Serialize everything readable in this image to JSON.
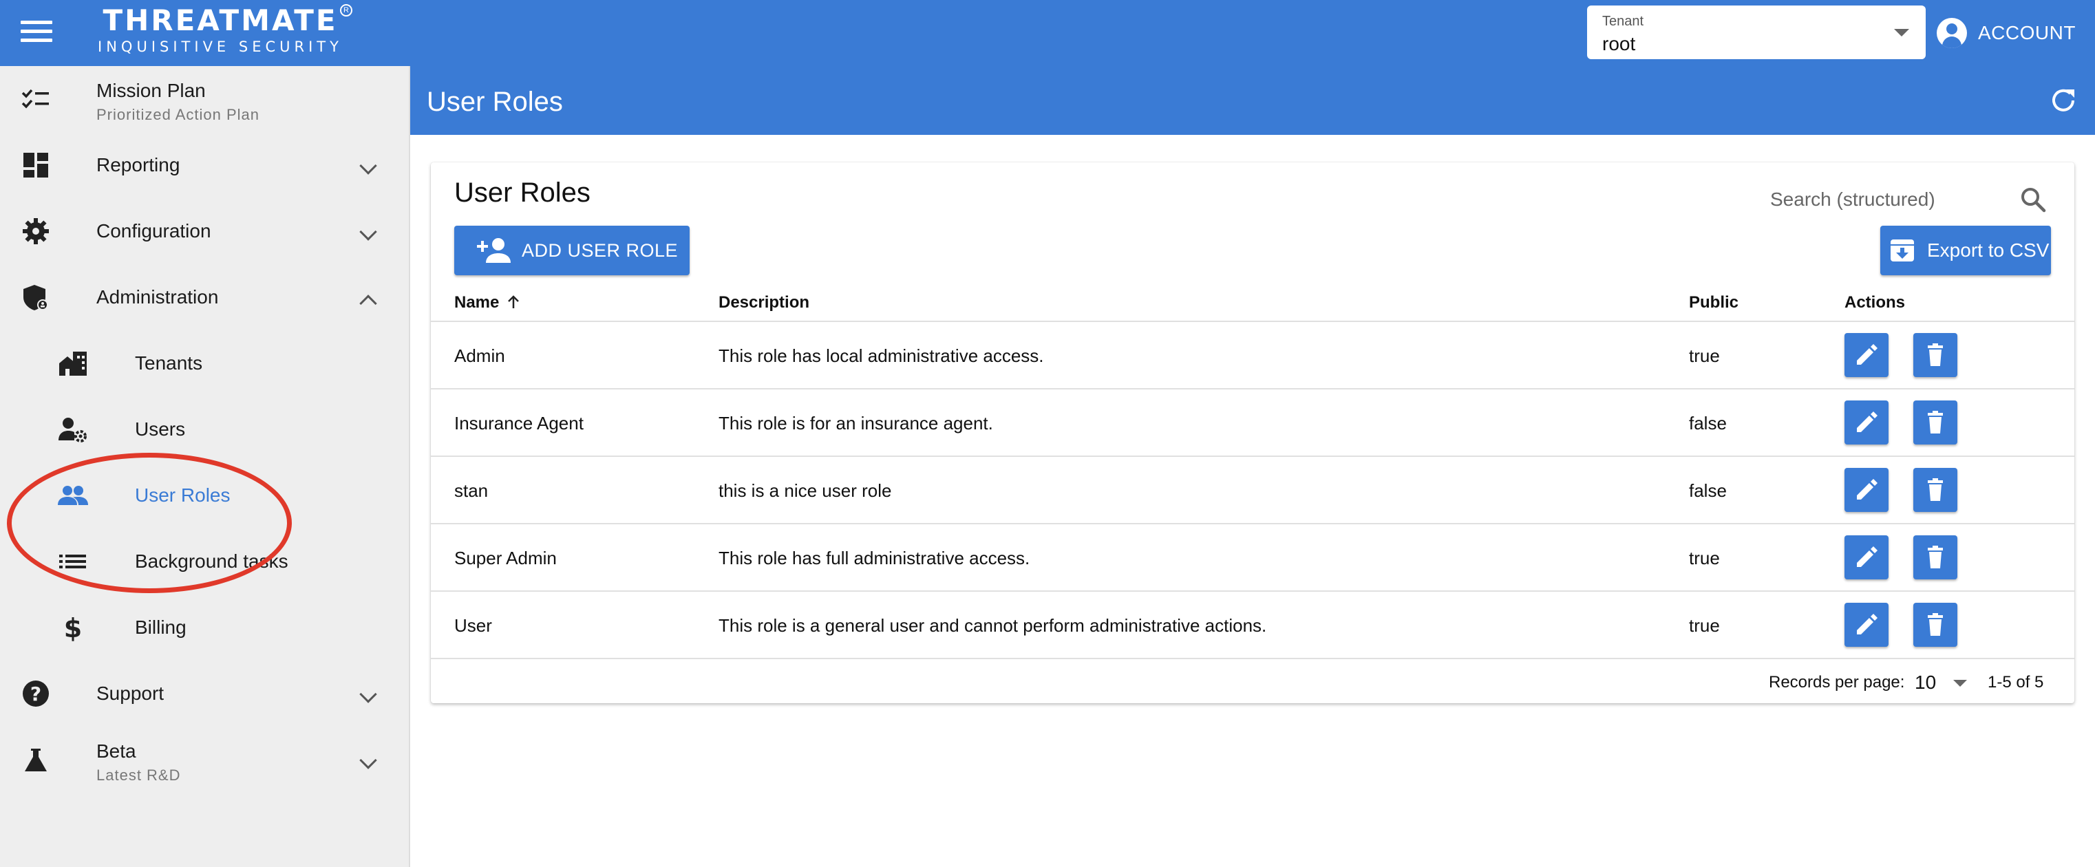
{
  "appbar": {
    "logo_main": "THREATMATE",
    "logo_sub": "INQUISITIVE SECURITY",
    "logo_reg": "R",
    "tenant_label": "Tenant",
    "tenant_value": "root",
    "account_label": "ACCOUNT"
  },
  "sidebar": {
    "items": [
      {
        "label": "Mission Plan",
        "secondary": "Prioritized Action Plan",
        "icon": "checklist-icon"
      },
      {
        "label": "Reporting",
        "icon": "dashboard-icon"
      },
      {
        "label": "Configuration",
        "icon": "gear-icon"
      },
      {
        "label": "Administration",
        "icon": "admin-shield-icon"
      },
      {
        "label": "Tenants",
        "icon": "buildings-icon"
      },
      {
        "label": "Users",
        "icon": "user-settings-icon"
      },
      {
        "label": "User Roles",
        "icon": "people-icon"
      },
      {
        "label": "Background tasks",
        "icon": "list-icon"
      },
      {
        "label": "Billing",
        "icon": "dollar-icon"
      },
      {
        "label": "Support",
        "icon": "help-icon"
      },
      {
        "label": "Beta",
        "secondary": "Latest R&D",
        "icon": "flask-icon"
      }
    ],
    "active": "User Roles"
  },
  "page": {
    "title": "User Roles"
  },
  "card": {
    "title": "User Roles",
    "search_placeholder": "Search (structured)",
    "add_button": "ADD USER ROLE",
    "export_button": "Export to CSV"
  },
  "table": {
    "columns": [
      "Name",
      "Description",
      "Public",
      "Actions"
    ],
    "sort": {
      "column": "Name",
      "direction": "ascending"
    },
    "rows": [
      {
        "name": "Admin",
        "description": "This role has local administrative access.",
        "public": "true"
      },
      {
        "name": "Insurance Agent",
        "description": "This role is for an insurance agent.",
        "public": "false"
      },
      {
        "name": "stan",
        "description": "this is a nice user role",
        "public": "false"
      },
      {
        "name": "Super Admin",
        "description": "This role has full administrative access.",
        "public": "true"
      },
      {
        "name": "User",
        "description": "This role is a general user and cannot perform administrative actions.",
        "public": "true"
      }
    ]
  },
  "pagination": {
    "records_per_page_label": "Records per page:",
    "records_per_page": "10",
    "range": "1-5 of 5"
  },
  "colors": {
    "primary": "#3a7bd5",
    "sidebar_bg": "#eeeeee",
    "highlight_ring": "#e0392a"
  }
}
